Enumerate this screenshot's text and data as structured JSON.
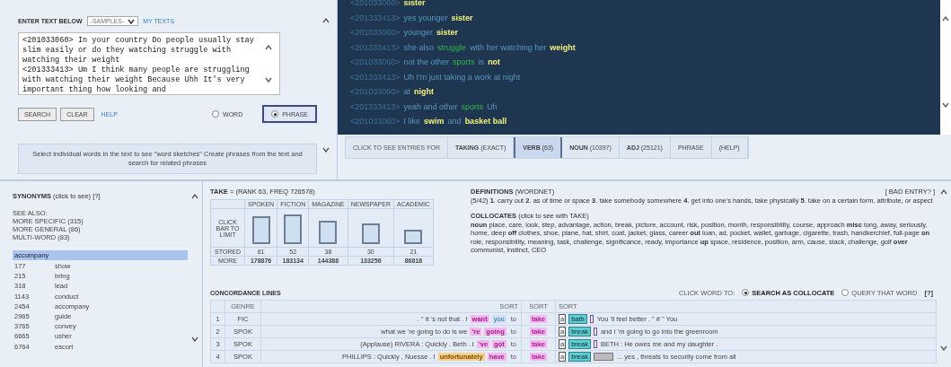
{
  "editor": {
    "title": "ENTER TEXT BELOW",
    "samples": "-SAMPLES-",
    "my_texts": "MY TEXTS",
    "text": "<201033060> In your country Do people usually stay slim easily or do they watching struggle with watching their weight\n<201333413> Um I think many people are struggling with watching their weight Because Uhh It's very important thing how looking and",
    "buttons": [
      "SEARCH",
      "CLEAR"
    ],
    "help": "HELP",
    "modes": [
      {
        "label": "WORD",
        "selected": false
      },
      {
        "label": "PHRASE",
        "selected": true
      }
    ],
    "hint": "Select individual words in the text to see \"word sketches\" Create phrases from the text and search for related phrases"
  },
  "transcript": {
    "lines": [
      {
        "speaker": "<201033060>",
        "segments": [
          {
            "text": "sister",
            "kind": "key"
          }
        ]
      },
      {
        "speaker": "<201333413>",
        "segments": [
          {
            "text": "yes younger",
            "kind": "plain"
          },
          {
            "text": "sister",
            "kind": "key"
          }
        ]
      },
      {
        "speaker": "<201033060>",
        "segments": [
          {
            "text": "younger",
            "kind": "plain"
          },
          {
            "text": "sister",
            "kind": "key"
          }
        ]
      },
      {
        "speaker": "<201333413>",
        "segments": [
          {
            "text": "she also",
            "kind": "plain"
          },
          {
            "text": "struggle",
            "kind": "match"
          },
          {
            "text": "with her watching her",
            "kind": "plain"
          },
          {
            "text": "weight",
            "kind": "key"
          }
        ]
      },
      {
        "speaker": "<201033060>",
        "segments": [
          {
            "text": "not the other",
            "kind": "plain"
          },
          {
            "text": "sports",
            "kind": "match"
          },
          {
            "text": "is",
            "kind": "plain"
          },
          {
            "text": "not",
            "kind": "key"
          }
        ]
      },
      {
        "speaker": "<201333413>",
        "segments": [
          {
            "text": "Uh I'm just taking a work at night",
            "kind": "plain"
          }
        ]
      },
      {
        "speaker": "<201033060>",
        "segments": [
          {
            "text": "at",
            "kind": "plain"
          },
          {
            "text": "night",
            "kind": "key"
          }
        ]
      },
      {
        "speaker": "<201333413>",
        "segments": [
          {
            "text": "yeah and other",
            "kind": "plain"
          },
          {
            "text": "sports",
            "kind": "match"
          },
          {
            "text": "Uh",
            "kind": "plain"
          }
        ]
      },
      {
        "speaker": "<201033060>",
        "segments": [
          {
            "text": "I like",
            "kind": "plain"
          },
          {
            "text": "swim",
            "kind": "key"
          },
          {
            "text": "and",
            "kind": "plain"
          },
          {
            "text": "basket ball",
            "kind": "key"
          }
        ]
      }
    ]
  },
  "entry_tabs": {
    "label": "CLICK TO SEE ENTRIES FOR",
    "tabs": [
      {
        "label": "**TAKING** (EXACT)",
        "selected": false
      },
      {
        "label": "**VERB** (63)",
        "selected": true
      },
      {
        "label": "**NOUN** (10397)",
        "selected": false
      },
      {
        "label": "**ADJ** (25121)",
        "selected": false
      },
      {
        "label": "PHRASE",
        "selected": false
      },
      {
        "label": "(HELP)",
        "selected": false
      }
    ]
  },
  "synonyms": {
    "title": "**SYNONYMS** (click to see) [?]",
    "see_also": [
      "SEE ALSO:",
      "MORE SPECIFIC (315)",
      "MORE GENERAL (86)",
      "MULTI-WORD (83)"
    ],
    "group": "accompany",
    "items": [
      {
        "rank": "177",
        "word": "show"
      },
      {
        "rank": "215",
        "word": "bring"
      },
      {
        "rank": "318",
        "word": "lead"
      },
      {
        "rank": "1143",
        "word": "conduct"
      },
      {
        "rank": "2454",
        "word": "accompany"
      },
      {
        "rank": "2965",
        "word": "guide"
      },
      {
        "rank": "3765",
        "word": "convey"
      },
      {
        "rank": "6665",
        "word": "usher"
      },
      {
        "rank": "6764",
        "word": "escort"
      }
    ]
  },
  "frequency": {
    "title": "**TAKE** =  (RANK 63, FREQ 726578)",
    "bar_label": "CLICK BAR TO LIMIT",
    "stored_label": "STORED",
    "more_label": "MORE",
    "genres": [
      {
        "name": "SPOKEN",
        "stored": "61",
        "more": "178876"
      },
      {
        "name": "FICTION",
        "stored": "52",
        "more": "183134"
      },
      {
        "name": "MAGAZINE",
        "stored": "38",
        "more": "144388"
      },
      {
        "name": "NEWSPAPER",
        "stored": "30",
        "more": "133256"
      },
      {
        "name": "ACADEMIC",
        "stored": "21",
        "more": "86818"
      }
    ]
  },
  "definitions": {
    "title": "**DEFINITIONS** (WORDNET)",
    "bad_entry": "[ BAD ENTRY? ]",
    "text": "(5/42) **1**. carry out **2**. as of time or space **3**. take somebody somewhere **4**. get into one's hands, take physically **5**. take on a certain form, attribute, or aspect",
    "collocates_title": "**COLLOCATES** (click to see with TAKE)",
    "collocates": "**noun** place, care, look, step, advantage, action, break, picture, account, risk, position, month, responsibility, course, approach **misc** long, away, seriously, home, deep **off** clothes, shoe, plane, hat, shirt, coat, jacket, glass, career **out** loan, ad, pocket, wallet, garbage, cigarette, trash, handkerchief, full-page **on** role, responsibility, meaning, task, challenge, significance, ready, importance **up** space, residence, position, arm, cause, slack, challenge, golf **over** communist, instinct, CEO"
  },
  "concordance": {
    "title": "CONCORDANCE LINES",
    "click_label": "CLICK WORD TO:",
    "options": [
      {
        "label": "SEARCH AS COLLOCATE",
        "selected": true
      },
      {
        "label": "QUERY THAT WORD",
        "selected": false
      }
    ],
    "help": "[?]",
    "columns": [
      "GENRE",
      "SORT",
      "SORT",
      "SORT"
    ],
    "rows": [
      {
        "number": "1",
        "genre": "FIC",
        "left": ". \" It 's not that . I",
        "tokens": [
          {
            "text": "want",
            "kind": "verb"
          },
          {
            "text": "you",
            "kind": "pron"
          },
          {
            "text": "to",
            "kind": "plain"
          }
        ],
        "node": "take",
        "article": "a",
        "noun": "bath",
        "kind": "empty",
        "right": "You 'll feel better . \" # \" You"
      },
      {
        "number": "2",
        "genre": "SPOK",
        "left": "what we 're going to do is we",
        "tokens": [
          {
            "text": "'re",
            "kind": "verb"
          },
          {
            "text": "going",
            "kind": "verb"
          },
          {
            "text": "to",
            "kind": "plain"
          }
        ],
        "node": "take",
        "article": "a",
        "noun": "break",
        "kind": "empty",
        "right": "and I 'm going to go into the greenroom"
      },
      {
        "number": "3",
        "genre": "SPOK",
        "left": "(Applause) RIVERA : Quickly . Beth . I",
        "tokens": [
          {
            "text": "'ve",
            "kind": "verb"
          },
          {
            "text": "got",
            "kind": "verb"
          },
          {
            "text": "to",
            "kind": "plain"
          }
        ],
        "node": "take",
        "article": "a",
        "noun": "break",
        "kind": "empty",
        "right": "BETH : He owes me and my daughter ."
      },
      {
        "number": "4",
        "genre": "SPOK",
        "left": "PHILLIPS : Quickly , Nuesse . I",
        "tokens": [
          {
            "text": "unfortunately",
            "kind": "adv"
          },
          {
            "text": "have",
            "kind": "verb"
          },
          {
            "text": "to",
            "kind": "plain"
          }
        ],
        "node": "take",
        "article": "a",
        "noun": "break",
        "kind": "grey",
        "right": "... yes , threats to security come from all"
      }
    ]
  }
}
